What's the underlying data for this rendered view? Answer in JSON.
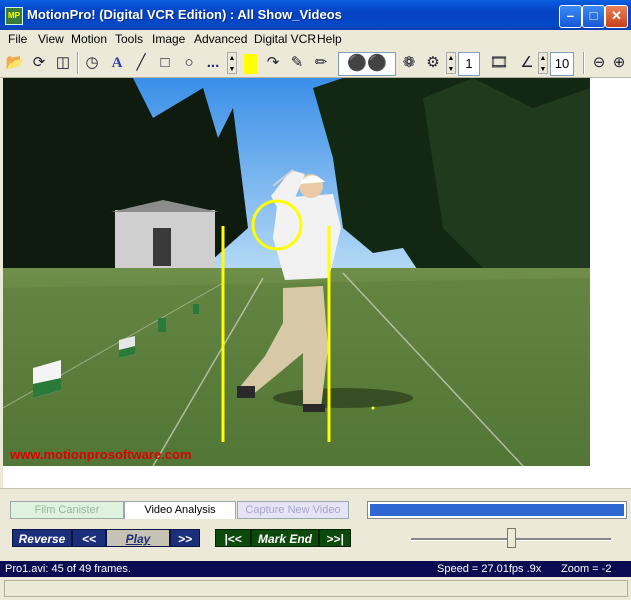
{
  "window": {
    "title": "MotionPro! (Digital VCR Edition) : All Show_Videos",
    "icon_text": "MP",
    "controls": [
      "minimize-icon",
      "maximize-icon",
      "close-icon"
    ]
  },
  "menu": [
    "File",
    "View",
    "Motion",
    "Tools",
    "Image",
    "Advanced",
    "Digital VCR",
    "Help"
  ],
  "toolbar": {
    "line_width_value": "...",
    "draw_color": "#ffff00",
    "frame_step_value": "1",
    "frame_count_value": "10",
    "icons": [
      "open-icon",
      "rotate-icon",
      "compare-icon",
      "timer-icon",
      "text-icon",
      "line-icon",
      "rectangle-icon",
      "circle-icon",
      "line-width-icon",
      "redo-icon",
      "eraser-icon",
      "clear-icon",
      "footprints-icon",
      "spiral-icon",
      "reel-icon",
      "filmstrip-icon",
      "angle-icon",
      "zoom-out-icon",
      "zoom-in-icon"
    ]
  },
  "video": {
    "watermark": "www.motionprosoftware.com"
  },
  "tabs": {
    "film_canister": "Film Canister",
    "video_analysis": "Video Analysis",
    "capture_new_video": "Capture New Video"
  },
  "progress": {
    "fraction": 1.0
  },
  "playback": {
    "reverse": "Reverse",
    "rewind": "<<",
    "play": "Play",
    "forward": ">>",
    "to_start": "|<<",
    "mark_end": "Mark End",
    "to_end": ">>|"
  },
  "speed_slider": {
    "fraction": 0.5
  },
  "status": {
    "file_info": "Pro1.avi:  45 of 49 frames.",
    "speed": "Speed = 27.01fps  .9x",
    "zoom": "Zoom = -2"
  },
  "colors": {
    "title_blue": "#0542c4",
    "status_bg": "#0b0b52",
    "button_navy": "#1c2f7a",
    "button_green": "#0c4a0c",
    "annotation_yellow": "#ffff00",
    "watermark_red": "#e00000"
  }
}
